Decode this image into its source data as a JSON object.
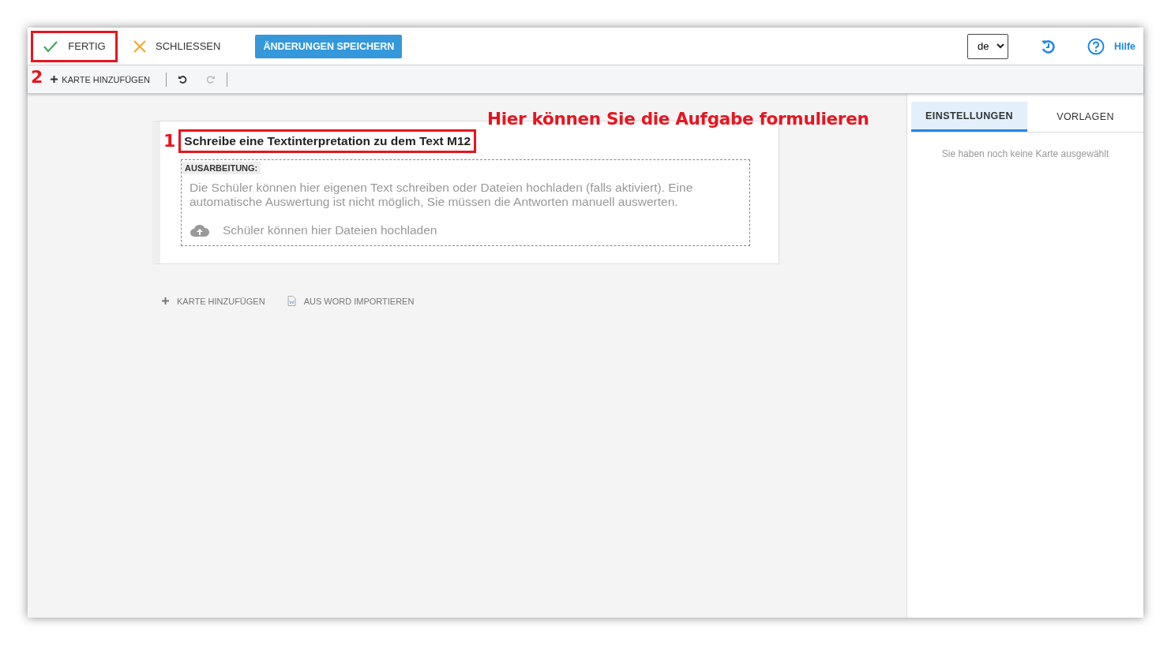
{
  "topbar": {
    "done_button": "FERTIG",
    "close_button": "SCHLIESSEN",
    "save_button": "ÄNDERUNGEN SPEICHERN",
    "language": "de",
    "help_link": "Hilfe"
  },
  "toolbar": {
    "add_card": "KARTE HINZUFÜGEN"
  },
  "card": {
    "title": "Schreibe eine Textinterpretation zu dem Text M12",
    "section_label": "AUSARBEITUNG:",
    "description": "Die Schüler können hier eigenen Text schreiben oder Dateien hochladen (falls aktiviert). Eine automatische Auswertung ist nicht möglich, Sie müssen die Antworten manuell auswerten.",
    "upload_hint": "Schüler können hier Dateien hochladen"
  },
  "actions": [
    "KARTE HINZUFÜGEN",
    "AUS WORD IMPORTIEREN"
  ],
  "side_panel": {
    "tabs": [
      {
        "label": "EINSTELLUNGEN",
        "selected": true
      },
      {
        "label": "VORLAGEN",
        "selected": false
      }
    ],
    "empty_message": "Sie haben noch keine Karte ausgewählt"
  },
  "annotations": {
    "number_1": "1",
    "number_2": "2",
    "callout": "Hier können Sie die Aufgabe formulieren"
  }
}
